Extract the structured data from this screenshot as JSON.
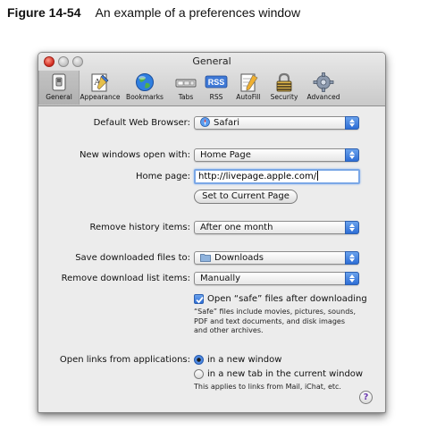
{
  "figure": {
    "number": "Figure 14-54",
    "caption": "An example of a preferences window"
  },
  "window": {
    "title": "General",
    "toolbar": [
      {
        "label": "General",
        "icon": "switch-icon",
        "selected": true
      },
      {
        "label": "Appearance",
        "icon": "appearance-icon",
        "selected": false
      },
      {
        "label": "Bookmarks",
        "icon": "globe-icon",
        "selected": false
      },
      {
        "label": "Tabs",
        "icon": "tabs-icon",
        "selected": false
      },
      {
        "label": "RSS",
        "icon": "rss-icon",
        "selected": false
      },
      {
        "label": "AutoFill",
        "icon": "autofill-icon",
        "selected": false
      },
      {
        "label": "Security",
        "icon": "lock-icon",
        "selected": false
      },
      {
        "label": "Advanced",
        "icon": "gear-icon",
        "selected": false
      }
    ],
    "rss_badge": "RSS"
  },
  "form": {
    "default_browser": {
      "label": "Default Web Browser:",
      "value": "Safari"
    },
    "new_windows": {
      "label": "New windows open with:",
      "value": "Home Page"
    },
    "home_page": {
      "label": "Home page:",
      "value": "http://livepage.apple.com/"
    },
    "set_current_button": "Set to Current Page",
    "remove_history": {
      "label": "Remove history items:",
      "value": "After one month"
    },
    "save_downloads": {
      "label": "Save downloaded files to:",
      "value": "Downloads"
    },
    "remove_download_list": {
      "label": "Remove download list items:",
      "value": "Manually"
    },
    "open_safe": {
      "label": "Open “safe” files after downloading",
      "checked": true,
      "note_lines": [
        "“Safe” files include movies, pictures, sounds,",
        "PDF and text documents, and disk images",
        "and other archives."
      ]
    },
    "open_links": {
      "label": "Open links from applications:",
      "options": [
        "in a new window",
        "in a new tab in the current window"
      ],
      "selected_index": 0,
      "note": "This applies to links from Mail, iChat, etc."
    },
    "help_button": "?"
  },
  "colors": {
    "accent": "#2e6ed6",
    "focus_ring": "#7aa7e6"
  }
}
